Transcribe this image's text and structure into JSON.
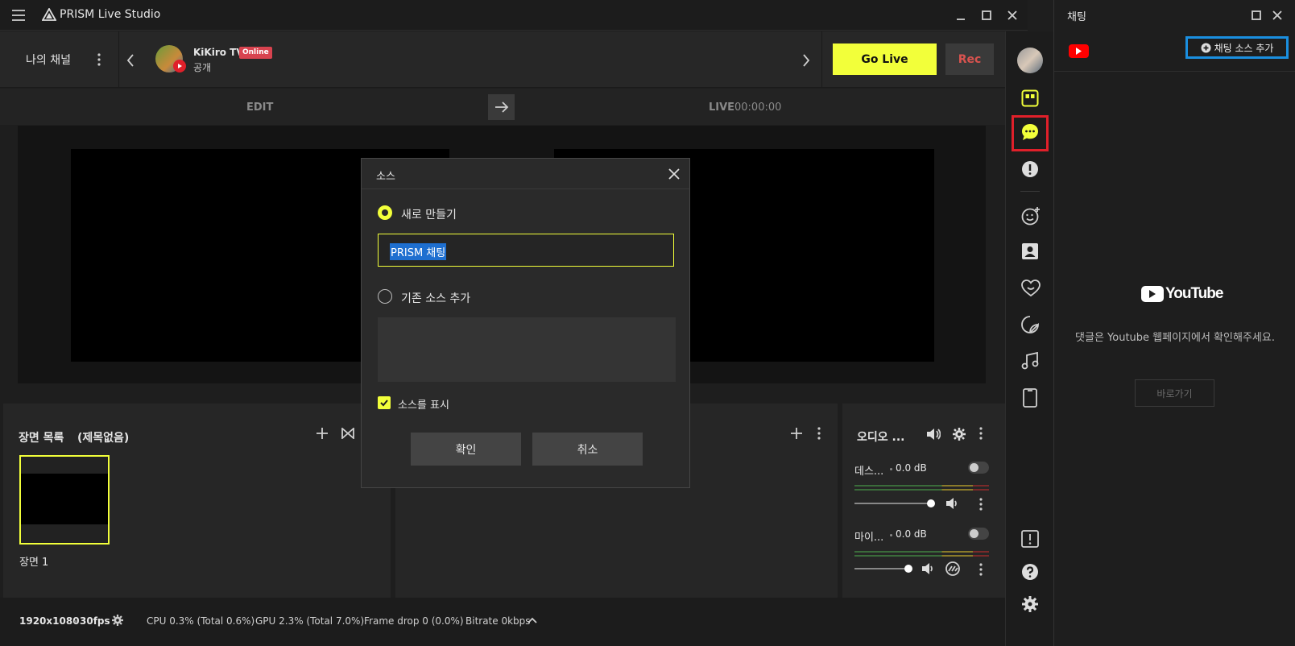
{
  "app": {
    "title": "PRISM Live Studio"
  },
  "channel": {
    "my_channel_label": "나의 채널",
    "name": "KiKiro TV",
    "status_badge": "Online",
    "visibility": "공개"
  },
  "actions": {
    "go_live": "Go Live",
    "rec": "Rec"
  },
  "editbar": {
    "edit_label": "EDIT",
    "live_label": "LIVE",
    "live_time": "00:00:00"
  },
  "scenes": {
    "header": "장면 목록",
    "collection": "(제목없음)",
    "items": [
      {
        "label": "장면 1"
      }
    ]
  },
  "audio": {
    "header": "오디오 ...",
    "channels": [
      {
        "name": "데스...",
        "db": "0.0 dB"
      },
      {
        "name": "마이...",
        "db": "0.0 dB"
      }
    ]
  },
  "status": {
    "resolution": "1920x1080",
    "fps": "30fps",
    "cpu": "CPU 0.3% (Total 0.6%)",
    "gpu": "GPU 2.3% (Total 7.0%)",
    "frame_drop": "Frame drop 0 (0.0%)",
    "bitrate": "Bitrate 0kbps"
  },
  "chat": {
    "window_title": "채팅",
    "add_source_button": "채팅 소스 추가",
    "youtube_logo_text": "YouTube",
    "message": "댓글은 Youtube 웹페이지에서 확인해주세요.",
    "goto_button": "바로가기"
  },
  "modal": {
    "title": "소스",
    "option_new": "새로 만들기",
    "name_value": "PRISM 채팅",
    "option_existing": "기존 소스 추가",
    "show_source_label": "소스를 표시",
    "show_source_checked": true,
    "confirm": "확인",
    "cancel": "취소"
  },
  "colors": {
    "accent_yellow": "#f2ff3a",
    "rec_red": "#d9534f",
    "highlight_red": "#e0202a",
    "highlight_blue": "#1a8fe0",
    "youtube_red": "#ff0000"
  }
}
